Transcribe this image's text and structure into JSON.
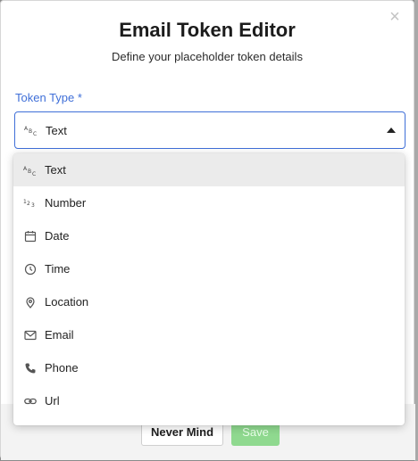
{
  "dialog": {
    "close_label": "×",
    "title": "Email Token Editor",
    "subtitle": "Define your placeholder token details"
  },
  "field": {
    "label": "Token Type *",
    "selected_value": "Text",
    "selected_icon": "text-type-icon"
  },
  "menu": {
    "options": [
      {
        "label": "Text",
        "icon": "text-type-icon",
        "selected": true
      },
      {
        "label": "Number",
        "icon": "number-type-icon"
      },
      {
        "label": "Date",
        "icon": "calendar-icon"
      },
      {
        "label": "Time",
        "icon": "clock-icon"
      },
      {
        "label": "Location",
        "icon": "map-pin-icon"
      },
      {
        "label": "Email",
        "icon": "envelope-icon"
      },
      {
        "label": "Phone",
        "icon": "phone-icon"
      },
      {
        "label": "Url",
        "icon": "link-icon"
      }
    ]
  },
  "footer": {
    "cancel_label": "Never Mind",
    "save_label": "Save"
  },
  "colors": {
    "accent": "#3f6fd8",
    "save_disabled": "#8fd98f",
    "selected_row": "#ebebeb"
  }
}
